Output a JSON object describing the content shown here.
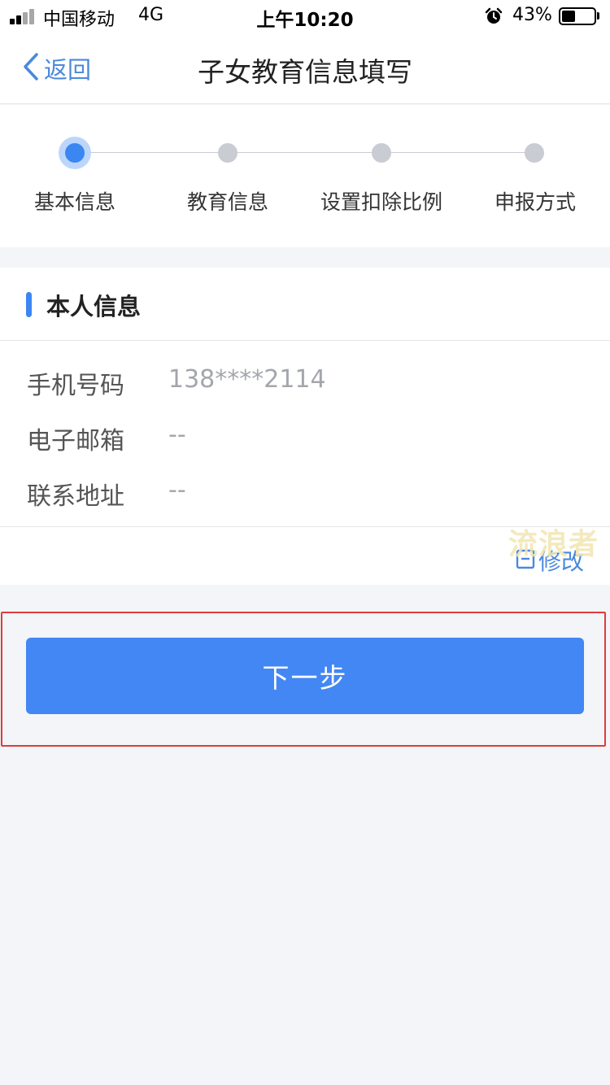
{
  "status_bar": {
    "carrier": "中国移动",
    "network": "4G",
    "time": "上午10:20",
    "battery_percent": "43%",
    "battery_level": 0.43
  },
  "nav": {
    "back_label": "返回",
    "title": "子女教育信息填写"
  },
  "stepper": {
    "steps": [
      {
        "label": "基本信息",
        "active": true
      },
      {
        "label": "教育信息",
        "active": false
      },
      {
        "label": "设置扣除比例",
        "active": false
      },
      {
        "label": "申报方式",
        "active": false
      }
    ]
  },
  "personal_info": {
    "title": "本人信息",
    "fields": [
      {
        "label": "手机号码",
        "value": "138****2114"
      },
      {
        "label": "电子邮箱",
        "value": "--"
      },
      {
        "label": "联系地址",
        "value": "--"
      }
    ],
    "edit_label": "修改"
  },
  "watermark": "流浪者",
  "footer": {
    "next_label": "下一步"
  },
  "colors": {
    "accent": "#3c86f2",
    "button": "#4387f4",
    "highlight": "#e03b3b",
    "background": "#f3f5f8"
  }
}
